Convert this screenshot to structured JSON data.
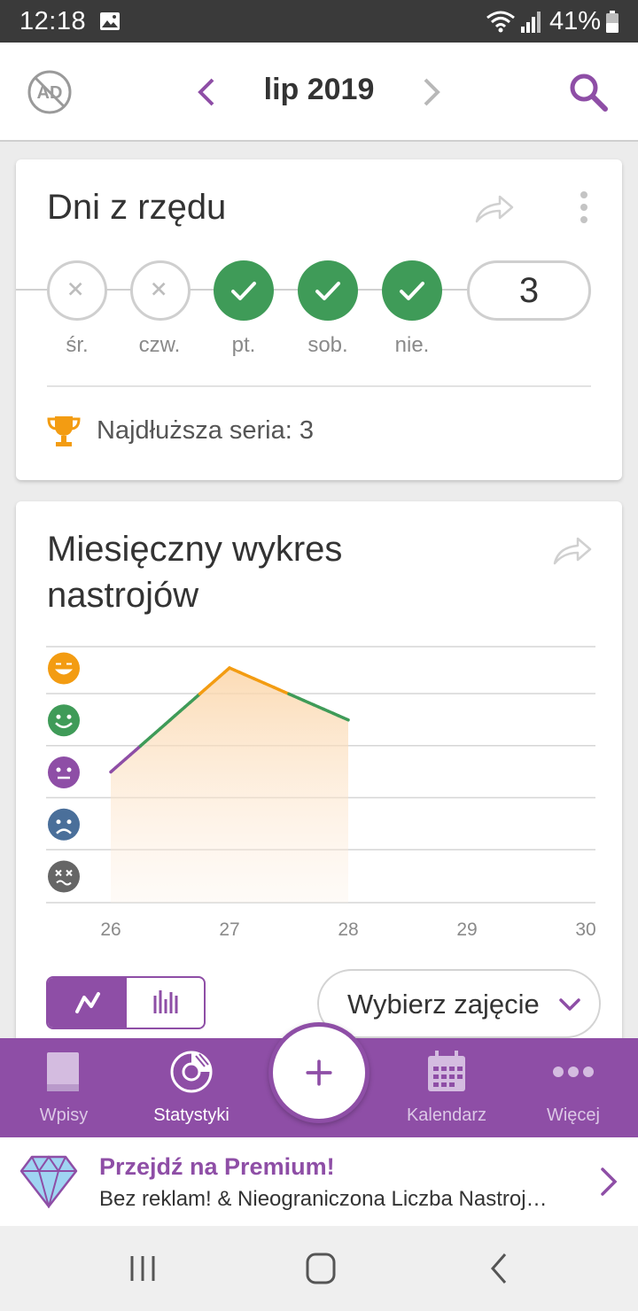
{
  "status_bar": {
    "time": "12:18",
    "battery": "41%"
  },
  "header": {
    "month": "lip 2019"
  },
  "streak_card": {
    "title": "Dni z rzędu",
    "days": [
      {
        "label": "śr.",
        "done": false
      },
      {
        "label": "czw.",
        "done": false
      },
      {
        "label": "pt.",
        "done": true
      },
      {
        "label": "sob.",
        "done": true
      },
      {
        "label": "nie.",
        "done": true
      }
    ],
    "current_streak": "3",
    "longest_streak": "Najdłuższa seria: 3"
  },
  "mood_chart_card": {
    "title_line1": "Miesięczny wykres",
    "title_line2": "nastrojów",
    "select_label": "Wybierz zajęcie"
  },
  "chart_data": {
    "type": "line",
    "x": [
      26,
      27,
      28
    ],
    "x_ticks": [
      "26",
      "27",
      "28",
      "29",
      "30"
    ],
    "xlim": [
      26,
      30
    ],
    "y_levels": [
      "rad",
      "good",
      "meh",
      "bad",
      "awful"
    ],
    "values": [
      3,
      5,
      4
    ],
    "ylim": [
      1,
      5
    ],
    "colors": {
      "rad": "#f39c12",
      "good": "#3f9b58",
      "meh": "#8e4ea6",
      "bad": "#4a6f9a",
      "awful": "#666666"
    }
  },
  "bottom_nav": {
    "items": [
      {
        "label": "Wpisy",
        "icon": "book-icon"
      },
      {
        "label": "Statystyki",
        "icon": "stats-icon"
      },
      {
        "label": "Kalendarz",
        "icon": "calendar-icon"
      },
      {
        "label": "Więcej",
        "icon": "more-icon"
      }
    ],
    "active": "Statystyki"
  },
  "premium_banner": {
    "title": "Przejdź na Premium!",
    "subtitle": "Bez reklam! & Nieograniczona Liczba Nastroj…"
  },
  "colors": {
    "accent": "#8e4ea6",
    "success": "#3f9b58",
    "trophy": "#f39c12"
  }
}
